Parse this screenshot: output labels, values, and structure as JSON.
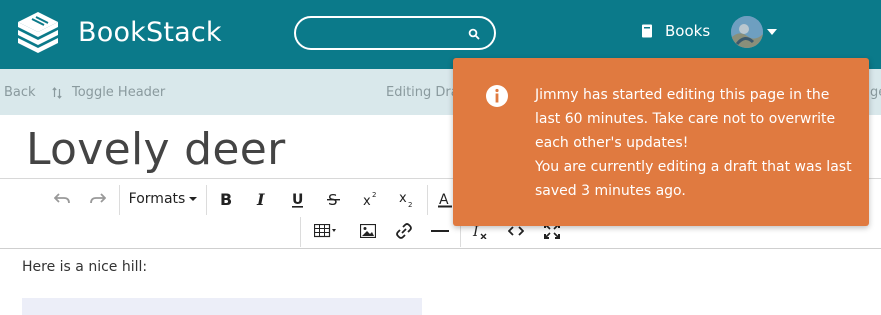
{
  "app": {
    "name": "BookStack"
  },
  "header": {
    "search_placeholder": "",
    "books_label": "Books",
    "colors": {
      "header_bg": "#0b7a8a",
      "accent": "#ffffff"
    }
  },
  "subbar": {
    "back_label": "Back",
    "toggle_label": "Toggle Header",
    "draft_label": "Editing Draft",
    "right_fragment": "ge"
  },
  "page": {
    "title": "Lovely deer"
  },
  "toolbar": {
    "formats_label": "Formats",
    "icons": [
      "undo-icon",
      "redo-icon",
      "bold-icon",
      "italic-icon",
      "underline-icon",
      "strikethrough-icon",
      "superscript-icon",
      "subscript-icon",
      "text-color-icon",
      "table-icon",
      "image-icon",
      "link-icon",
      "horizontal-rule-icon",
      "clear-format-icon",
      "code-icon",
      "fullscreen-icon"
    ]
  },
  "content": {
    "first_line": "Here is a nice hill:"
  },
  "notification": {
    "line1": "Jimmy has started editing this page in the last 60 minutes. Take care not to overwrite each other's updates!",
    "line2": "You are currently editing a draft that was last saved 3 minutes ago.",
    "color": "#e07a40"
  }
}
